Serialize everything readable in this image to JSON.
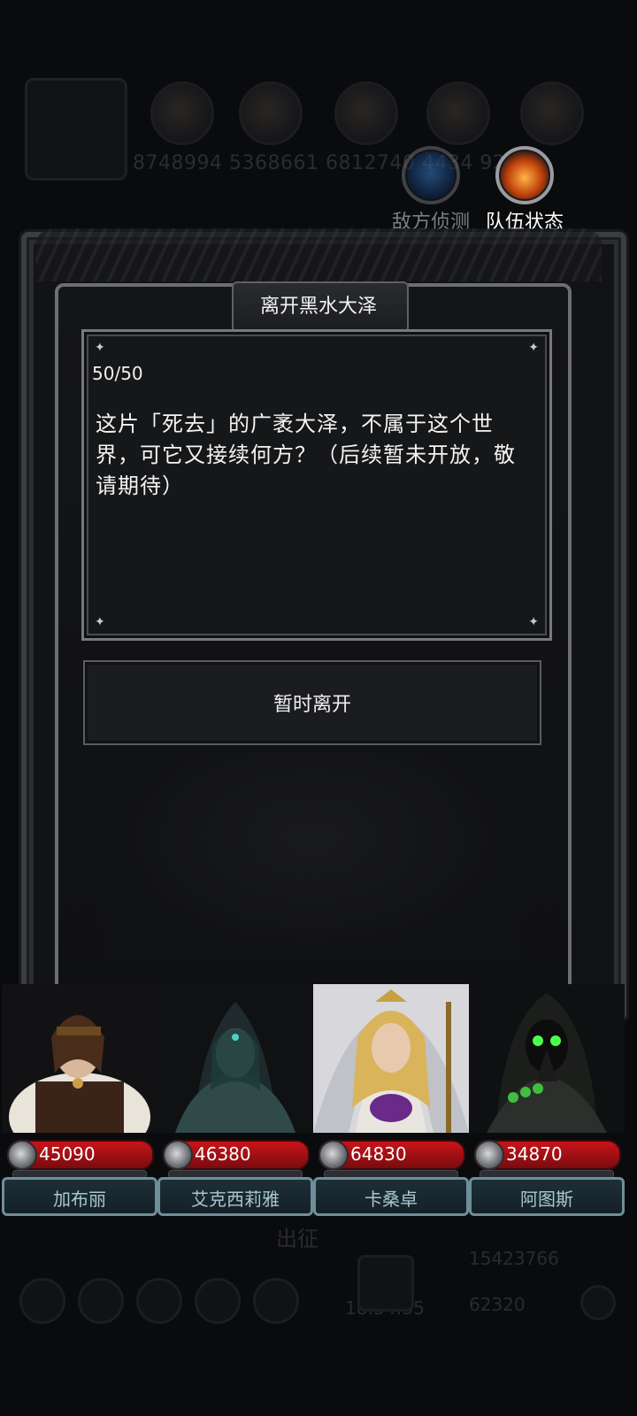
{
  "background": {
    "resource_values": "8748994 5368661 6812740 4434 929",
    "center_label": "出征",
    "bottom_value_1": "15423766",
    "bottom_value_2": "62320",
    "clock": "18:54:55"
  },
  "top_buttons": {
    "enemy_scout": "敌方侦测",
    "team_status": "队伍状态"
  },
  "dialog": {
    "title": "离开黑水大泽",
    "counter": "50/50",
    "message": "这片「死去」的广袤大泽，不属于这个世界，可它又接续何方？（后续暂未开放，敬请期待）",
    "button_label": "暂时离开"
  },
  "heroes": [
    {
      "name": "加布丽",
      "power": "45090",
      "theme_color": "#d8c7a8"
    },
    {
      "name": "艾克西莉雅",
      "power": "46380",
      "theme_color": "#2f6a63"
    },
    {
      "name": "卡桑卓",
      "power": "64830",
      "theme_color": "#d9b45a"
    },
    {
      "name": "阿图斯",
      "power": "34870",
      "theme_color": "#3fbf3f"
    }
  ],
  "colors": {
    "hp_red": "#c9141a",
    "name_border": "#6e8f99",
    "frame_border": "#6b6e74"
  }
}
